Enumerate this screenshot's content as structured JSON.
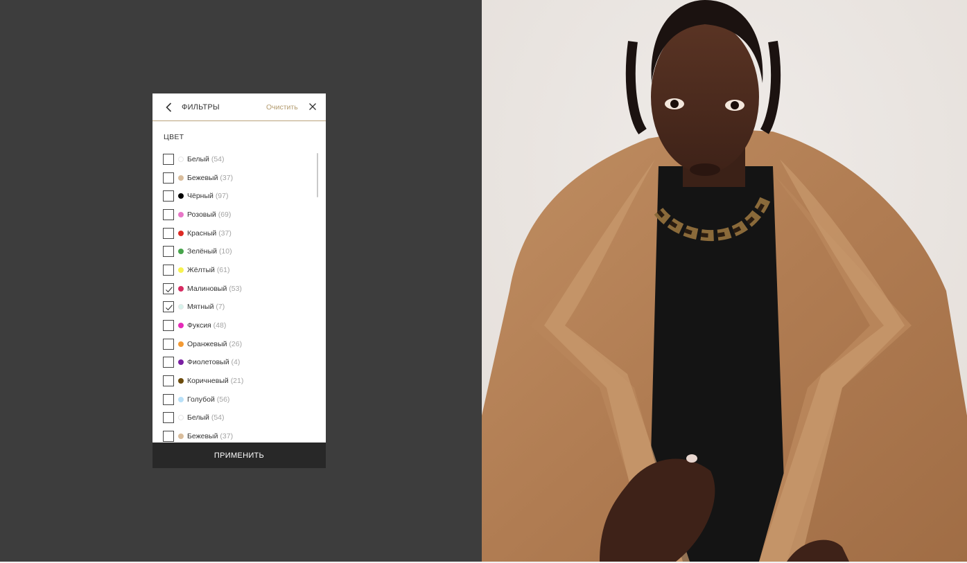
{
  "filter_panel": {
    "title": "ФИЛЬТРЫ",
    "clear_label": "Очистить",
    "section_label": "ЦВЕТ",
    "apply_label": "ПРИМЕНИТЬ",
    "colors": [
      {
        "label": "Белый",
        "count": "(54)",
        "swatch": "#ffffff",
        "checked": false
      },
      {
        "label": "Бежевый",
        "count": "(37)",
        "swatch": "#d9bd9c",
        "checked": false
      },
      {
        "label": "Чёрный",
        "count": "(97)",
        "swatch": "#000000",
        "checked": false
      },
      {
        "label": "Розовый",
        "count": "(69)",
        "swatch": "#e877c7",
        "checked": false
      },
      {
        "label": "Красный",
        "count": "(37)",
        "swatch": "#dd2a24",
        "checked": false
      },
      {
        "label": "Зелёный",
        "count": "(10)",
        "swatch": "#47a44b",
        "checked": false
      },
      {
        "label": "Жёлтый",
        "count": "(61)",
        "swatch": "#f7f24f",
        "checked": false
      },
      {
        "label": "Малиновый",
        "count": "(53)",
        "swatch": "#d72b61",
        "checked": true
      },
      {
        "label": "Мятный",
        "count": "(7)",
        "swatch": "#d6f4ec",
        "checked": true
      },
      {
        "label": "Фуксия",
        "count": "(48)",
        "swatch": "#e52ab8",
        "checked": false
      },
      {
        "label": "Оранжевый",
        "count": "(26)",
        "swatch": "#f39a34",
        "checked": false
      },
      {
        "label": "Фиолетовый",
        "count": "(4)",
        "swatch": "#7a1fa2",
        "checked": false
      },
      {
        "label": "Коричневый",
        "count": "(21)",
        "swatch": "#6c4b0c",
        "checked": false
      },
      {
        "label": "Голубой",
        "count": "(56)",
        "swatch": "#b8e0f8",
        "checked": false
      },
      {
        "label": "Белый",
        "count": "(54)",
        "swatch": "#ffffff",
        "checked": false
      },
      {
        "label": "Бежевый",
        "count": "(37)",
        "swatch": "#d9bd9c",
        "checked": false
      }
    ]
  },
  "icons": {
    "back": "chevron-left-icon",
    "close": "close-icon",
    "check": "checkmark-icon"
  },
  "colors": {
    "accent": "#b39b6e",
    "backdrop": "#3d3d3d",
    "apply_button": "#282828"
  }
}
